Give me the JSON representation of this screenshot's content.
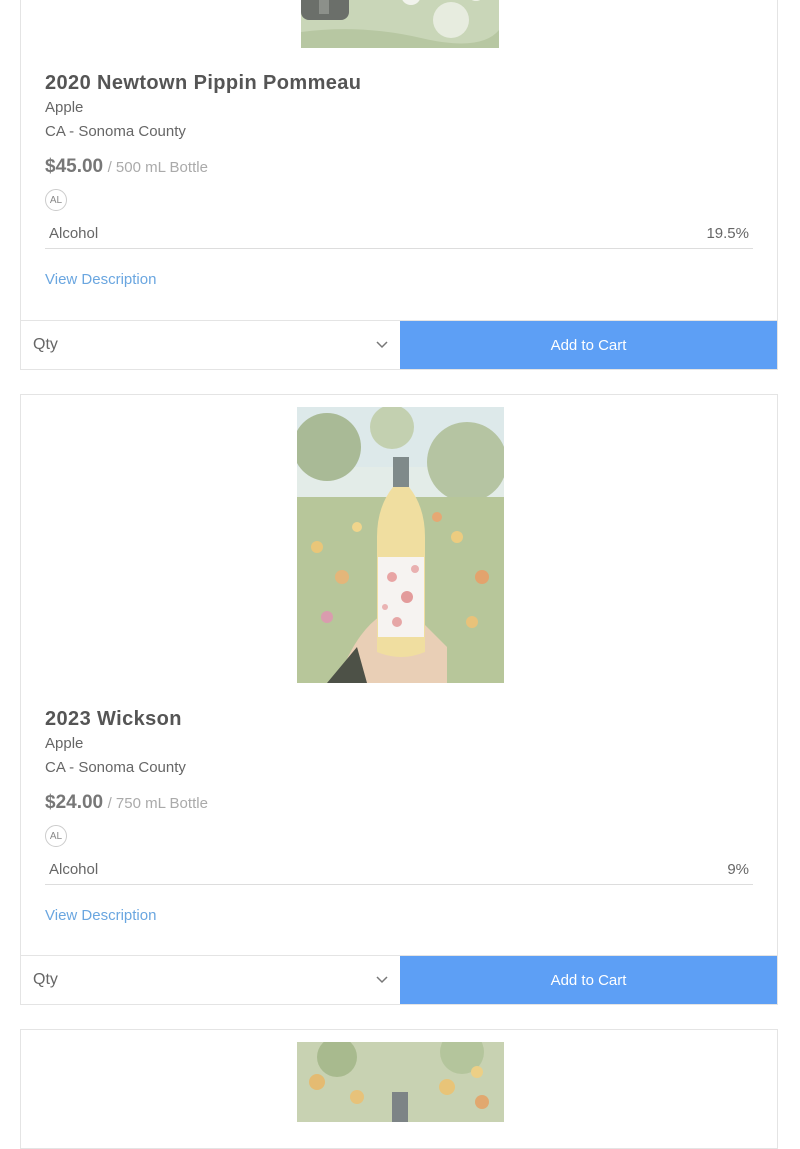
{
  "products": [
    {
      "name": "2020 Newtown Pippin Pommeau",
      "varietal": "Apple",
      "region": "CA - Sonoma County",
      "price": "$45.00",
      "unit": "/ 500 mL Bottle",
      "badge": "AL",
      "spec_label": "Alcohol",
      "spec_value": "19.5%",
      "link": "View Description",
      "qty_placeholder": "Qty",
      "add_label": "Add to Cart"
    },
    {
      "name": "2023 Wickson",
      "varietal": "Apple",
      "region": "CA - Sonoma County",
      "price": "$24.00",
      "unit": "/ 750 mL Bottle",
      "badge": "AL",
      "spec_label": "Alcohol",
      "spec_value": "9%",
      "link": "View Description",
      "qty_placeholder": "Qty",
      "add_label": "Add to Cart"
    }
  ],
  "colors": {
    "accent": "#5d9ff5",
    "link": "#6aa6e0"
  },
  "icons": {
    "select": "chevron-down-icon"
  }
}
